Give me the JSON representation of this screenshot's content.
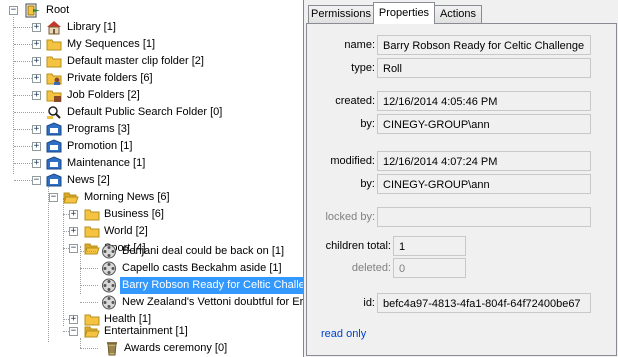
{
  "tree": {
    "root": "Root",
    "items": [
      {
        "label": "Library [1]",
        "icon": "library-icon"
      },
      {
        "label": "My Sequences [1]",
        "icon": "folder-icon"
      },
      {
        "label": "Default master clip folder [2]",
        "icon": "folder-icon"
      },
      {
        "label": "Private folders [6]",
        "icon": "private-folder-icon"
      },
      {
        "label": "Job Folders [2]",
        "icon": "job-folder-icon"
      },
      {
        "label": "Default Public Search Folder [0]",
        "icon": "search-folder-icon"
      },
      {
        "label": "Programs [3]",
        "icon": "bin-icon"
      },
      {
        "label": "Promotion [1]",
        "icon": "bin-icon"
      },
      {
        "label": "Maintenance [1]",
        "icon": "bin-icon"
      },
      {
        "label": "News [2]",
        "icon": "bin-icon"
      },
      {
        "label": "Morning News [6]",
        "icon": "folder-open-icon"
      },
      {
        "label": "Business [6]",
        "icon": "folder-icon"
      },
      {
        "label": "World [2]",
        "icon": "folder-icon"
      },
      {
        "label": "Sport [4]",
        "icon": "folder-open-icon"
      },
      {
        "label": "Benjani deal could be back on [1]",
        "icon": "film-reel-icon"
      },
      {
        "label": "Capello casts Beckahm aside [1]",
        "icon": "film-reel-icon"
      },
      {
        "label": "Barry Robson Ready for Celtic Challer",
        "icon": "film-reel-icon"
      },
      {
        "label": "New Zealand's Vettoni doubtful for Er",
        "icon": "film-reel-icon"
      },
      {
        "label": "Health [1]",
        "icon": "folder-icon"
      },
      {
        "label": "Entertainment [1]",
        "icon": "folder-open-icon"
      },
      {
        "label": "Awards ceremony [0]",
        "icon": "trash-bin-icon"
      }
    ]
  },
  "tabs": [
    "Permissions",
    "Properties",
    "Actions"
  ],
  "properties": {
    "name_label": "name:",
    "name_value": "Barry Robson Ready for Celtic Challenge",
    "type_label": "type:",
    "type_value": "Roll",
    "created_label": "created:",
    "created_value": "12/16/2014 4:05:46 PM",
    "created_by_label": "by:",
    "created_by_value": "CINEGY-GROUP\\ann",
    "modified_label": "modified:",
    "modified_value": "12/16/2014 4:07:24 PM",
    "modified_by_label": "by:",
    "modified_by_value": "CINEGY-GROUP\\ann",
    "locked_by_label": "locked by:",
    "locked_by_value": "",
    "children_total_label": "children total:",
    "children_total_value": "1",
    "deleted_label": "deleted:",
    "deleted_value": "0",
    "id_label": "id:",
    "id_value": "befc4a97-4813-4fa1-804f-64f72400be67",
    "read_only": "read only"
  },
  "colors": {
    "selection": "#3399ff",
    "folder": "#f5c342",
    "bin": "#2e6fc4",
    "link": "#0044cc"
  }
}
